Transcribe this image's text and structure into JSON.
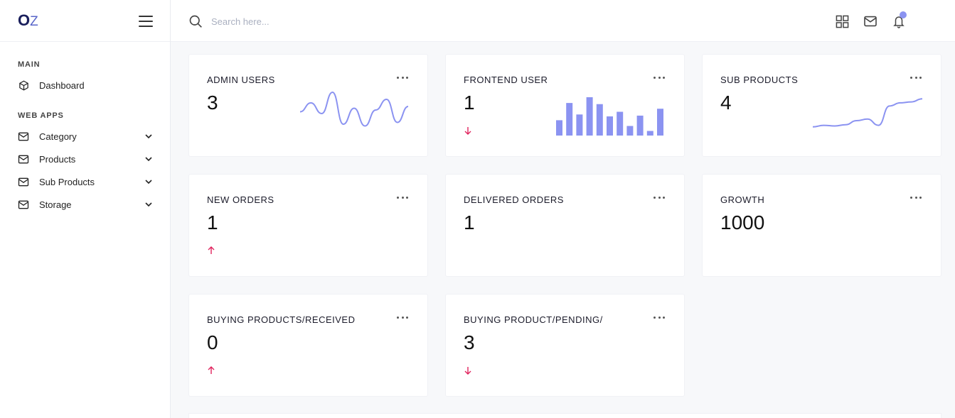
{
  "app": {
    "logo_main": "O",
    "logo_accent": "Z"
  },
  "header": {
    "search_placeholder": "Search here..."
  },
  "sidebar": {
    "sections": [
      {
        "label": "MAIN"
      },
      {
        "label": "WEB APPS"
      }
    ],
    "items": [
      {
        "label": "Dashboard",
        "icon": "cube-icon"
      },
      {
        "label": "Category",
        "icon": "mail-icon"
      },
      {
        "label": "Products",
        "icon": "mail-icon"
      },
      {
        "label": "Sub Products",
        "icon": "mail-icon"
      },
      {
        "label": "Storage",
        "icon": "mail-icon"
      }
    ]
  },
  "colors": {
    "accent": "#8b93f1",
    "arrow": "#e0245e",
    "logo": "#1a1f5c"
  },
  "cards": [
    {
      "title": "ADMIN USERS",
      "value": "3",
      "arrow": null,
      "chart": "wave"
    },
    {
      "title": "FRONTEND USER",
      "value": "1",
      "arrow": "down",
      "chart": "bars"
    },
    {
      "title": "SUB PRODUCTS",
      "value": "4",
      "arrow": null,
      "chart": "line"
    },
    {
      "title": "NEW ORDERS",
      "value": "1",
      "arrow": "up",
      "chart": null
    },
    {
      "title": "DELIVERED ORDERS",
      "value": "1",
      "arrow": null,
      "chart": null
    },
    {
      "title": "GROWTH",
      "value": "1000",
      "arrow": null,
      "chart": null
    },
    {
      "title": "BUYING PRODUCTS/RECEIVED",
      "value": "0",
      "arrow": "up",
      "chart": null
    },
    {
      "title": "BUYING PRODUCT/PENDING/",
      "value": "3",
      "arrow": "down",
      "chart": null
    }
  ],
  "sparklines": {
    "wave": [
      0.55,
      0.3,
      0.6,
      0.0,
      0.9,
      0.45,
      0.95,
      0.5,
      0.2,
      0.85,
      0.4
    ],
    "bars": [
      0.4,
      0.85,
      0.55,
      1.0,
      0.82,
      0.5,
      0.62,
      0.25,
      0.52,
      0.12,
      0.7
    ],
    "line": [
      0.05,
      0.1,
      0.08,
      0.12,
      0.25,
      0.3,
      0.1,
      0.72,
      0.82,
      0.85,
      0.95
    ]
  }
}
